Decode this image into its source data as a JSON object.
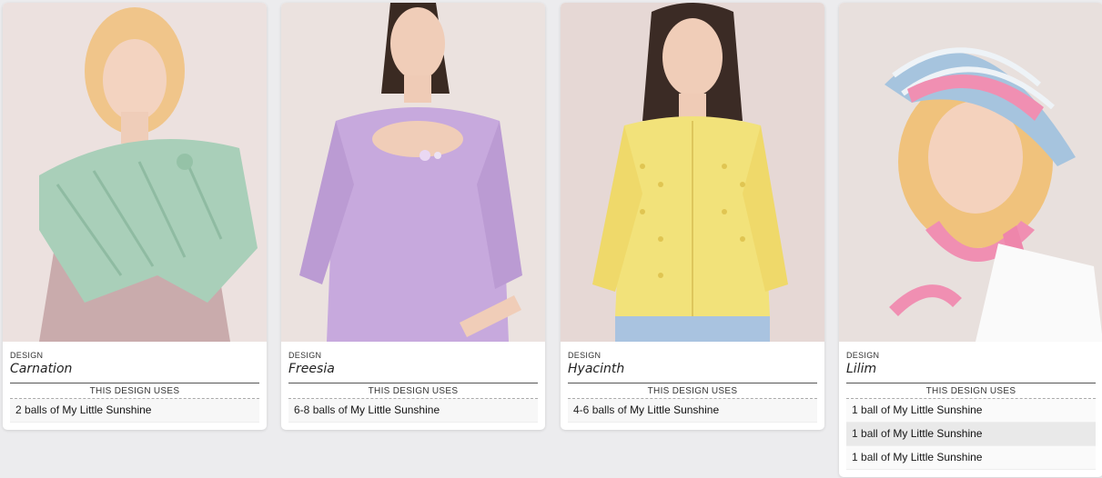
{
  "labels": {
    "design": "DESIGN",
    "uses": "THIS DESIGN USES",
    "balls_of": "balls of",
    "ball_of": "ball of"
  },
  "yarn": "My Little Sunshine",
  "cards": [
    {
      "name": "Carnation",
      "rows": [
        {
          "qty": "2"
        }
      ]
    },
    {
      "name": "Freesia",
      "rows": [
        {
          "qty": "6-8"
        }
      ]
    },
    {
      "name": "Hyacinth",
      "rows": [
        {
          "qty": "4-6"
        }
      ]
    },
    {
      "name": "Lilim",
      "rows": [
        {
          "qty": "1"
        },
        {
          "qty": "1"
        },
        {
          "qty": "1"
        }
      ]
    }
  ],
  "colors": {
    "background": "#ececee",
    "card": "#ffffff",
    "mint": "#a9cfb9",
    "lilac": "#c7a9dd",
    "yellow": "#f2e27a",
    "pink": "#f08fb2",
    "stripe_blue": "#a6c4de"
  }
}
